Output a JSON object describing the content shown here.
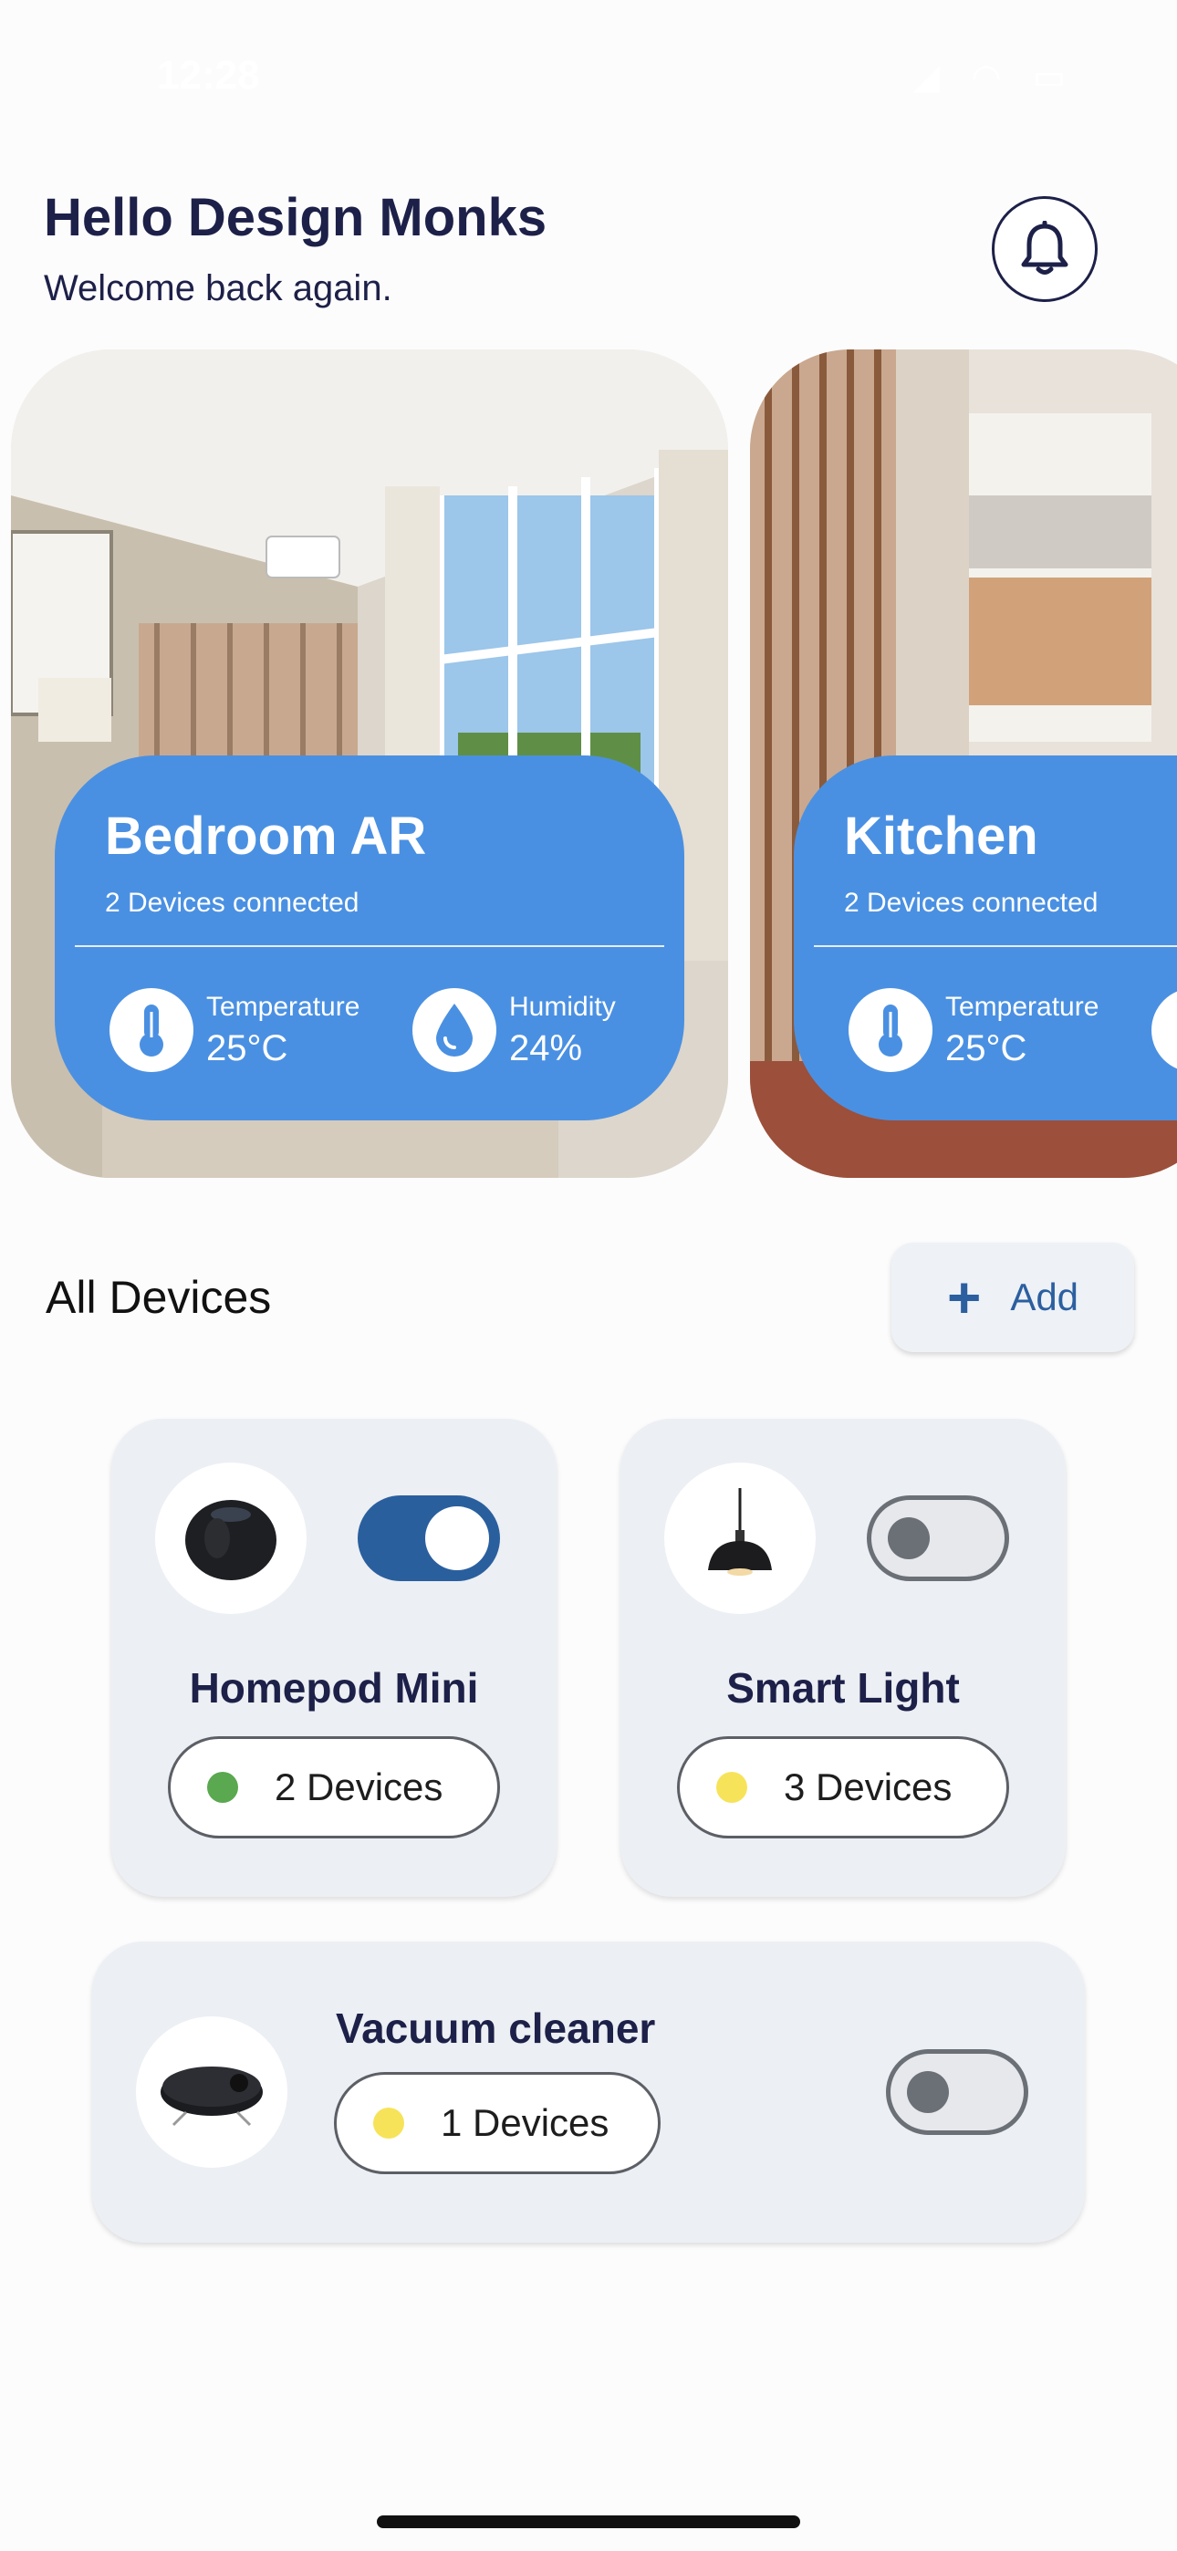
{
  "status_bar": {
    "time": "12:28",
    "icons": "◢ ◠ ▭"
  },
  "greeting": {
    "title": "Hello Design Monks",
    "subtitle": "Welcome back again."
  },
  "rooms": [
    {
      "name": "Bedroom AR",
      "devices": "2 Devices connected",
      "temperature_label": "Temperature",
      "temperature_value": "25°C",
      "humidity_label": "Humidity",
      "humidity_value": "24%"
    },
    {
      "name": "Kitchen",
      "devices": "2 Devices connected",
      "temperature_label": "Temperature",
      "temperature_value": "25°C"
    }
  ],
  "devices_section": {
    "title": "All Devices",
    "add_label": "Add"
  },
  "devices": [
    {
      "name": "Homepod Mini",
      "count": "2 Devices",
      "on": true,
      "dot_color": "#5aa84f"
    },
    {
      "name": "Smart Light",
      "count": "3 Devices",
      "on": false,
      "dot_color": "#f7e35a"
    },
    {
      "name": "Vacuum cleaner",
      "count": "1 Devices",
      "on": false,
      "dot_color": "#f7e35a"
    }
  ],
  "colors": {
    "accent": "#4a90e2",
    "toggle_on": "#2a5f9e",
    "heading": "#1d2048"
  }
}
